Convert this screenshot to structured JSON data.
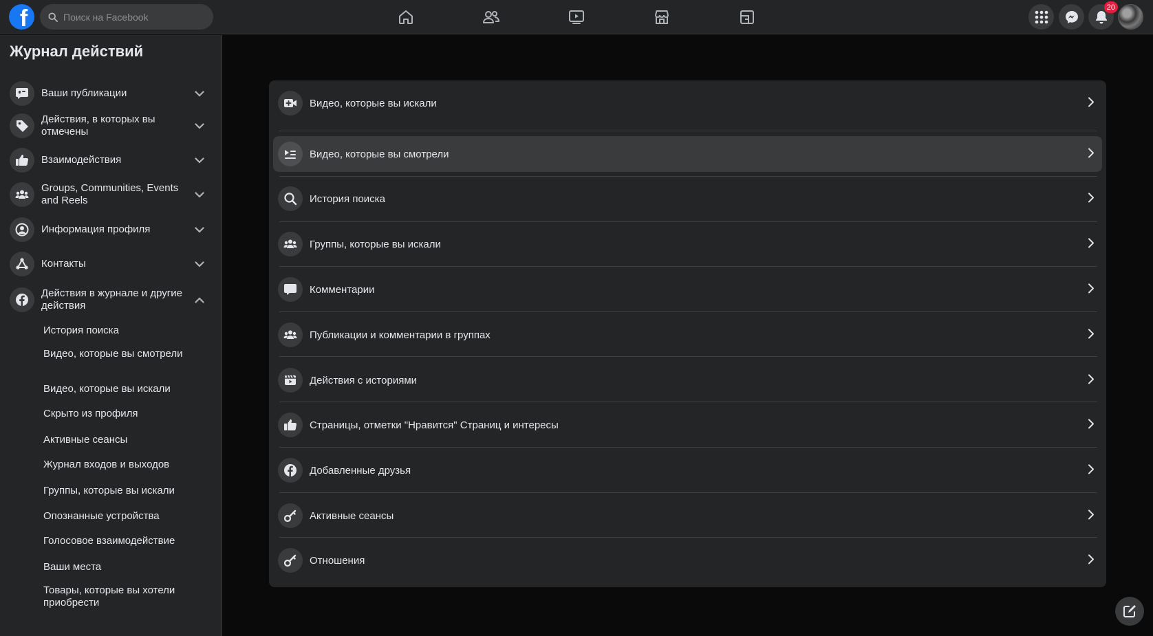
{
  "search": {
    "placeholder": "Поиск на Facebook"
  },
  "logo": {
    "letter": "f",
    "color": "#1877f2"
  },
  "top_nav": [
    {
      "name": "home-icon"
    },
    {
      "name": "friends-icon"
    },
    {
      "name": "watch-icon"
    },
    {
      "name": "marketplace-icon"
    },
    {
      "name": "gaming-icon"
    }
  ],
  "header_right": {
    "notifications_badge": "20",
    "badge_color": "#e41e3f"
  },
  "sidebar": {
    "title": "Журнал действий",
    "sections": [
      {
        "label": "Ваши публикации",
        "icon": "chat-bubble-icon",
        "expanded": false
      },
      {
        "label": "Действия, в которых вы отмечены",
        "icon": "tag-icon",
        "expanded": false
      },
      {
        "label": "Взаимодействия",
        "icon": "thumbs-up-icon",
        "expanded": false
      },
      {
        "label": "Groups, Communities, Events and Reels",
        "icon": "groups-icon",
        "expanded": false
      },
      {
        "label": "Информация профиля",
        "icon": "profile-icon",
        "expanded": false
      },
      {
        "label": "Контакты",
        "icon": "network-icon",
        "expanded": false
      },
      {
        "label": "Действия в журнале и другие действия",
        "icon": "facebook-icon",
        "expanded": true
      }
    ],
    "sub_items": [
      "История поиска",
      "Видео, которые вы смотрели",
      "Видео, которые вы искали",
      "Скрыто из профиля",
      "Активные сеансы",
      "Журнал входов и выходов",
      "Группы, которые вы искали",
      "Опознанные устройства",
      "Голосовое взаимодействие",
      "Ваши места",
      "Товары, которые вы хотели приобрести"
    ]
  },
  "main": {
    "items": [
      {
        "label": "Видео, которые вы искали",
        "icon": "video-add-icon",
        "active": false
      },
      {
        "label": "Видео, которые вы смотрели",
        "icon": "video-list-icon",
        "active": true
      },
      {
        "label": "История поиска",
        "icon": "search-icon",
        "active": false
      },
      {
        "label": "Группы, которые вы искали",
        "icon": "groups-icon",
        "active": false
      },
      {
        "label": "Комментарии",
        "icon": "comment-icon",
        "active": false
      },
      {
        "label": "Публикации и комментарии в группах",
        "icon": "groups-icon",
        "active": false
      },
      {
        "label": "Действия с историями",
        "icon": "stories-icon",
        "active": false
      },
      {
        "label": "Страницы, отметки \"Нравится\" Страниц и интересы",
        "icon": "thumbs-up-icon",
        "active": false
      },
      {
        "label": "Добавленные друзья",
        "icon": "facebook-icon",
        "active": false
      },
      {
        "label": "Активные сеансы",
        "icon": "key-icon",
        "active": false
      },
      {
        "label": "Отношения",
        "icon": "key-icon",
        "active": false
      }
    ]
  }
}
